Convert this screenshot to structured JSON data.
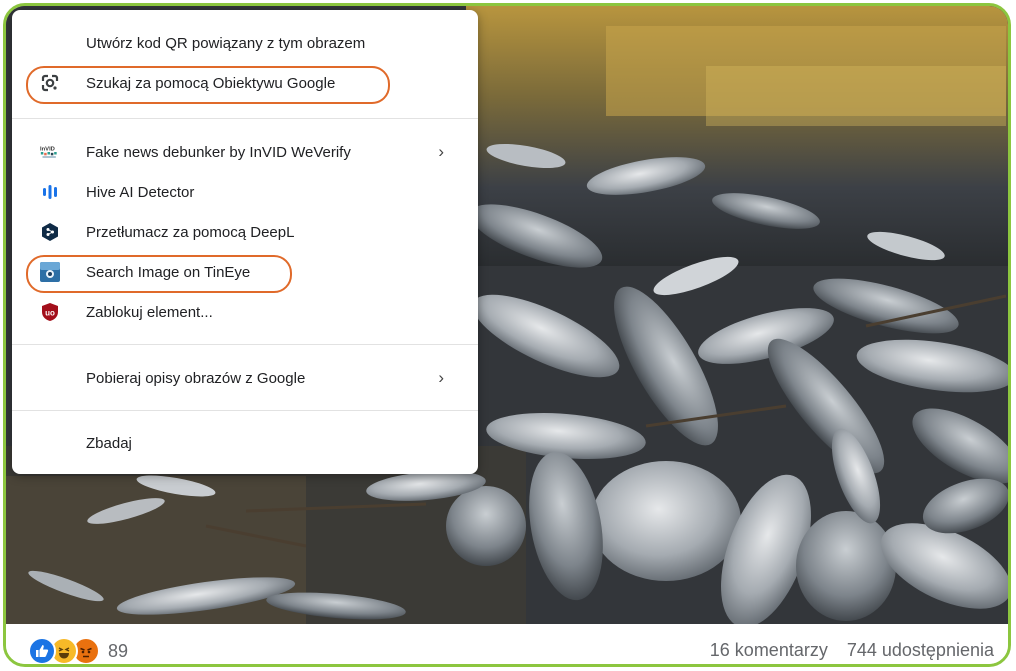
{
  "menu": {
    "items": [
      {
        "label": "Utwórz kod QR powiązany z tym obrazem",
        "icon": "none"
      },
      {
        "label": "Szukaj za pomocą Obiektywu Google",
        "icon": "google-lens-icon"
      },
      {
        "label": "Fake news debunker by InVID  WeVerify",
        "icon": "invid-icon",
        "submenu": true
      },
      {
        "label": "Hive AI Detector",
        "icon": "hive-icon"
      },
      {
        "label": "Przetłumacz za pomocą DeepL",
        "icon": "deepl-icon"
      },
      {
        "label": "Search Image on TinEye",
        "icon": "tineye-icon"
      },
      {
        "label": "Zablokuj element...",
        "icon": "ublock-icon"
      },
      {
        "label": "Pobieraj opisy obrazów z Google",
        "icon": "none",
        "submenu": true
      },
      {
        "label": "Zbadaj",
        "icon": "none"
      }
    ],
    "highlighted": [
      "Szukaj za pomocą Obiektywu Google",
      "Search Image on TinEye"
    ],
    "highlight_color": "#e06a2a",
    "invid_logo_text": "InVID"
  },
  "footer": {
    "reaction_count": "89",
    "reactions": [
      "like",
      "haha",
      "angry"
    ],
    "comments": "16 komentarzy",
    "shares": "744 udostępnienia"
  },
  "colors": {
    "frame_border": "#8cc63f",
    "reaction_like": "#1b74e4",
    "reaction_haha": "#f7b928",
    "reaction_angry": "#e9710f"
  }
}
